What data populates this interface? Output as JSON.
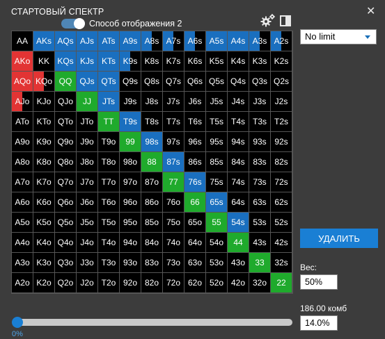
{
  "window": {
    "title": "СТАРТОВЫЙ СПЕКТР",
    "close_glyph": "✕"
  },
  "toolbar": {
    "toggle_label": "Способ отображения 2",
    "toggle_on": true,
    "icons": [
      "gear-icon",
      "panel-icon"
    ]
  },
  "game_select": {
    "value": "No limit"
  },
  "colors": {
    "red": "#e23434",
    "blue": "#1a6fbf",
    "green": "#1faa2c",
    "cell_bg": "#000000",
    "accent": "#1a7fd4"
  },
  "grid": {
    "rows": [
      [
        "AA",
        "AKs",
        "AQs",
        "AJs",
        "ATs",
        "A9s",
        "A8s",
        "A7s",
        "A6s",
        "A5s",
        "A4s",
        "A3s",
        "A2s"
      ],
      [
        "AKo",
        "KK",
        "KQs",
        "KJs",
        "KTs",
        "K9s",
        "K8s",
        "K7s",
        "K6s",
        "K5s",
        "K4s",
        "K3s",
        "K2s"
      ],
      [
        "AQo",
        "KQo",
        "QQ",
        "QJs",
        "QTs",
        "Q9s",
        "Q8s",
        "Q7s",
        "Q6s",
        "Q5s",
        "Q4s",
        "Q3s",
        "Q2s"
      ],
      [
        "AJo",
        "KJo",
        "QJo",
        "JJ",
        "JTs",
        "J9s",
        "J8s",
        "J7s",
        "J6s",
        "J5s",
        "J4s",
        "J3s",
        "J2s"
      ],
      [
        "ATo",
        "KTo",
        "QTo",
        "JTo",
        "TT",
        "T9s",
        "T8s",
        "T7s",
        "T6s",
        "T5s",
        "T4s",
        "T3s",
        "T2s"
      ],
      [
        "A9o",
        "K9o",
        "Q9o",
        "J9o",
        "T9o",
        "99",
        "98s",
        "97s",
        "96s",
        "95s",
        "94s",
        "93s",
        "92s"
      ],
      [
        "A8o",
        "K8o",
        "Q8o",
        "J8o",
        "T8o",
        "98o",
        "88",
        "87s",
        "86s",
        "85s",
        "84s",
        "83s",
        "82s"
      ],
      [
        "A7o",
        "K7o",
        "Q7o",
        "J7o",
        "T7o",
        "97o",
        "87o",
        "77",
        "76s",
        "75s",
        "74s",
        "73s",
        "72s"
      ],
      [
        "A6o",
        "K6o",
        "Q6o",
        "J6o",
        "T6o",
        "96o",
        "86o",
        "76o",
        "66",
        "65s",
        "64s",
        "63s",
        "62s"
      ],
      [
        "A5o",
        "K5o",
        "Q5o",
        "J5o",
        "T5o",
        "95o",
        "85o",
        "75o",
        "65o",
        "55",
        "54s",
        "53s",
        "52s"
      ],
      [
        "A4o",
        "K4o",
        "Q4o",
        "J4o",
        "T4o",
        "94o",
        "84o",
        "74o",
        "64o",
        "54o",
        "44",
        "43s",
        "42s"
      ],
      [
        "A3o",
        "K3o",
        "Q3o",
        "J3o",
        "T3o",
        "93o",
        "83o",
        "73o",
        "63o",
        "53o",
        "43o",
        "33",
        "32s"
      ],
      [
        "A2o",
        "K2o",
        "Q2o",
        "J2o",
        "T2o",
        "92o",
        "82o",
        "72o",
        "62o",
        "52o",
        "42o",
        "32o",
        "22"
      ]
    ],
    "highlights": {
      "AKs": [
        "blue",
        1
      ],
      "AQs": [
        "blue",
        1
      ],
      "AJs": [
        "blue",
        1
      ],
      "ATs": [
        "blue",
        1
      ],
      "A9s": [
        "blue",
        1
      ],
      "A8s": [
        "blue",
        0.5
      ],
      "A7s": [
        "blue",
        0.5
      ],
      "A6s": [
        "blue",
        0.5
      ],
      "A5s": [
        "blue",
        1
      ],
      "A4s": [
        "blue",
        1
      ],
      "A3s": [
        "blue",
        0.5
      ],
      "A2s": [
        "blue",
        0.5
      ],
      "AKo": [
        "red",
        1
      ],
      "KQs": [
        "blue",
        1
      ],
      "KJs": [
        "blue",
        1
      ],
      "KTs": [
        "blue",
        1
      ],
      "K9s": [
        "blue",
        0.5
      ],
      "AQo": [
        "red",
        1
      ],
      "KQo": [
        "red",
        0.5
      ],
      "QQ": [
        "green",
        1
      ],
      "QJs": [
        "blue",
        1
      ],
      "QTs": [
        "blue",
        1
      ],
      "AJo": [
        "red",
        0.5
      ],
      "JJ": [
        "green",
        1
      ],
      "JTs": [
        "blue",
        1
      ],
      "TT": [
        "green",
        1
      ],
      "T9s": [
        "blue",
        1
      ],
      "99": [
        "green",
        1
      ],
      "98s": [
        "blue",
        1
      ],
      "88": [
        "green",
        1
      ],
      "87s": [
        "blue",
        1
      ],
      "77": [
        "green",
        1
      ],
      "76s": [
        "blue",
        1
      ],
      "66": [
        "green",
        1
      ],
      "65s": [
        "blue",
        1
      ],
      "55": [
        "green",
        1
      ],
      "54s": [
        "blue",
        1
      ],
      "44": [
        "green",
        1
      ],
      "33": [
        "green",
        1
      ],
      "22": [
        "green",
        1
      ]
    }
  },
  "actions": {
    "delete_label": "УДАЛИТЬ"
  },
  "weight": {
    "label": "Вес:",
    "value": "50%"
  },
  "combos": {
    "label": "186.00 комб",
    "value": "14.0%"
  },
  "slider": {
    "value_label": "0%",
    "fraction": 0.0
  }
}
